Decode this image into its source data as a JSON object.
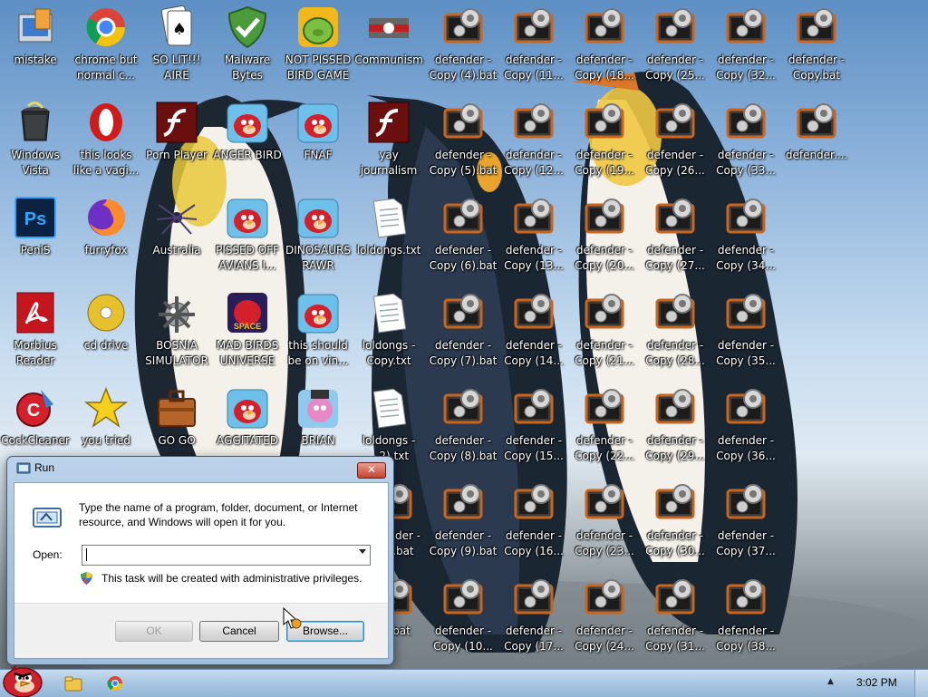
{
  "desktop": {
    "icons": [
      {
        "label": "mistake",
        "type": "setup"
      },
      {
        "label": "chrome but normal c...",
        "type": "chrome"
      },
      {
        "label": "SO LIT!!! AIRE",
        "type": "cards"
      },
      {
        "label": "Malware Bytes",
        "type": "shield"
      },
      {
        "label": "NOT PISSED BIRD GAME",
        "type": "pig"
      },
      {
        "label": "Communism",
        "type": "flag"
      },
      {
        "label": "Windows Vista",
        "type": "bin"
      },
      {
        "label": "this looks like a vagi...",
        "type": "opera"
      },
      {
        "label": "Porn Player",
        "type": "flash"
      },
      {
        "label": "ANGER BIRD",
        "type": "bird"
      },
      {
        "label": "FNAF",
        "type": "bird"
      },
      {
        "label": "yay journalism",
        "type": "flash"
      },
      {
        "label": "PeniS",
        "type": "ps"
      },
      {
        "label": "furryfox",
        "type": "firefox"
      },
      {
        "label": "Australia",
        "type": "spider"
      },
      {
        "label": "PISSED OFF AVIANS I...",
        "type": "bird"
      },
      {
        "label": "DINOSAURS RAWR",
        "type": "bird"
      },
      {
        "label": "loldongs.txt",
        "type": "txt"
      },
      {
        "label": "Morbius Reader",
        "type": "pdf"
      },
      {
        "label": "cd drive",
        "type": "cd"
      },
      {
        "label": "BOSNIA SIMULATOR",
        "type": "mine"
      },
      {
        "label": "MAD BIRDS UNIVERSE",
        "type": "space"
      },
      {
        "label": "this should be on vin...",
        "type": "bird"
      },
      {
        "label": "loldongs - Copy.txt",
        "type": "txt"
      },
      {
        "label": "CockCleaner",
        "type": "ccleaner"
      },
      {
        "label": "you tried",
        "type": "star"
      },
      {
        "label": "GO GO",
        "type": "case"
      },
      {
        "label": "AGGITATED",
        "type": "bird"
      },
      {
        "label": "BRIAN",
        "type": "brian"
      },
      {
        "label": "loldongs - ...2).txt",
        "type": "txt"
      }
    ],
    "defender_icons": [
      "defender - Copy (4).bat",
      "defender - Copy (11...",
      "defender - Copy (18...",
      "defender - Copy (25...",
      "defender - Copy (32...",
      "defender - Copy.bat",
      "defender - Copy (5).bat",
      "defender - Copy (12...",
      "defender - Copy (19...",
      "defender - Copy (26...",
      "defender - Copy (33...",
      "defender....",
      "defender - Copy (6).bat",
      "defender - Copy (13...",
      "defender - Copy (20...",
      "defender - Copy (27...",
      "defender - Copy (34...",
      "defender - Copy (7).bat",
      "defender - Copy (14...",
      "defender - Copy (21...",
      "defender - Copy (28...",
      "defender - Copy (35...",
      "defender - Copy (8).bat",
      "defender - Copy (15...",
      "defender - Copy (22...",
      "defender - Copy (29...",
      "defender - Copy (36...",
      "defender - ...2).bat",
      "defender - Copy (9).bat",
      "defender - Copy (16...",
      "defender - Copy (23...",
      "defender - Copy (30...",
      "defender - Copy (37...",
      "...).bat",
      "defender - Copy (10...",
      "defender - Copy (17...",
      "defender - Copy (24...",
      "defender - Copy (31...",
      "defender - Copy (38..."
    ]
  },
  "run_dialog": {
    "title": "Run",
    "close_glyph": "✕",
    "description": "Type the name of a program, folder, document, or Internet resource, and Windows will open it for you.",
    "open_label": "Open:",
    "open_value": "",
    "admin_note": "This task will be created with administrative privileges.",
    "ok_label": "OK",
    "cancel_label": "Cancel",
    "browse_label": "Browse..."
  },
  "taskbar": {
    "clock": "3:02 PM",
    "tray_arrow": "▲"
  },
  "colors": {
    "accent": "#3d5c7e",
    "bird": "#d4202a",
    "defender": "#c9651d"
  }
}
